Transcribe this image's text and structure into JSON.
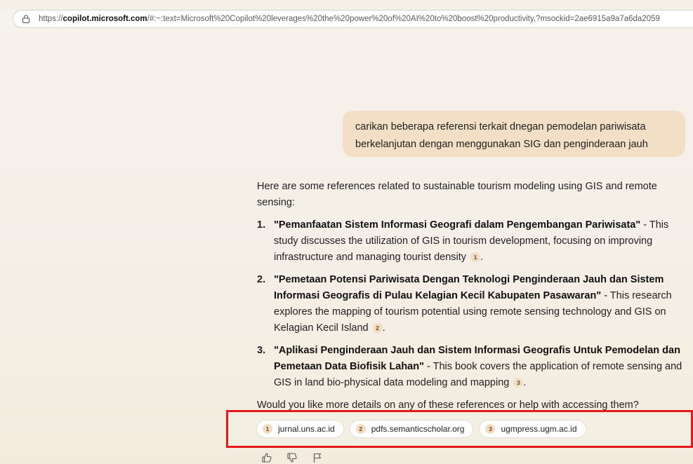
{
  "browser": {
    "url_prefix": "https://",
    "url_domain": "copilot.microsoft.com",
    "url_rest": "/#:~:text=Microsoft%20Copilot%20leverages%20the%20power%20of%20AI%20to%20boost%20productivity,?msockid=2ae6915a9a7a6da2059"
  },
  "chat": {
    "user_message": "carikan beberapa referensi terkait dnegan pemodelan pariwisata berkelanjutan dengan menggunakan SIG dan penginderaan jauh",
    "intro": "Here are some references related to sustainable tourism modeling using GIS and remote sensing:",
    "references": [
      {
        "num": "1.",
        "title": "\"Pemanfaatan Sistem Informasi Geografi dalam Pengembangan Pariwisata\"",
        "desc": " - This study discusses the utilization of GIS in tourism development, focusing on improving infrastructure and managing tourist density",
        "cite": "1"
      },
      {
        "num": "2.",
        "title": "\"Pemetaan Potensi Pariwisata Dengan Teknologi Penginderaan Jauh dan Sistem Informasi Geografis di Pulau Kelagian Kecil Kabupaten Pasawaran\"",
        "desc": " - This research explores the mapping of tourism potential using remote sensing technology and GIS on Kelagian Kecil Island",
        "cite": "2"
      },
      {
        "num": "3.",
        "title": "\"Aplikasi Penginderaan Jauh dan Sistem Informasi Geografis Untuk Pemodelan dan Pemetaan Data Biofisik Lahan\"",
        "desc": " - This book covers the application of remote sensing and GIS in land bio-physical data modeling and mapping",
        "cite": "3"
      }
    ],
    "period": ".",
    "closing": "Would you like more details on any of these references or help with accessing them?",
    "sources": [
      {
        "num": "1",
        "label": "jurnal.uns.ac.id"
      },
      {
        "num": "2",
        "label": "pdfs.semanticscholar.org"
      },
      {
        "num": "3",
        "label": "ugmpress.ugm.ac.id"
      }
    ],
    "actions": [
      "thumbs-up-icon",
      "thumbs-down-icon",
      "flag-icon"
    ]
  },
  "colors": {
    "highlight_border": "#e31b1b",
    "user_bubble": "#f3dfc6",
    "cite_badge": "#f1ddc1"
  }
}
